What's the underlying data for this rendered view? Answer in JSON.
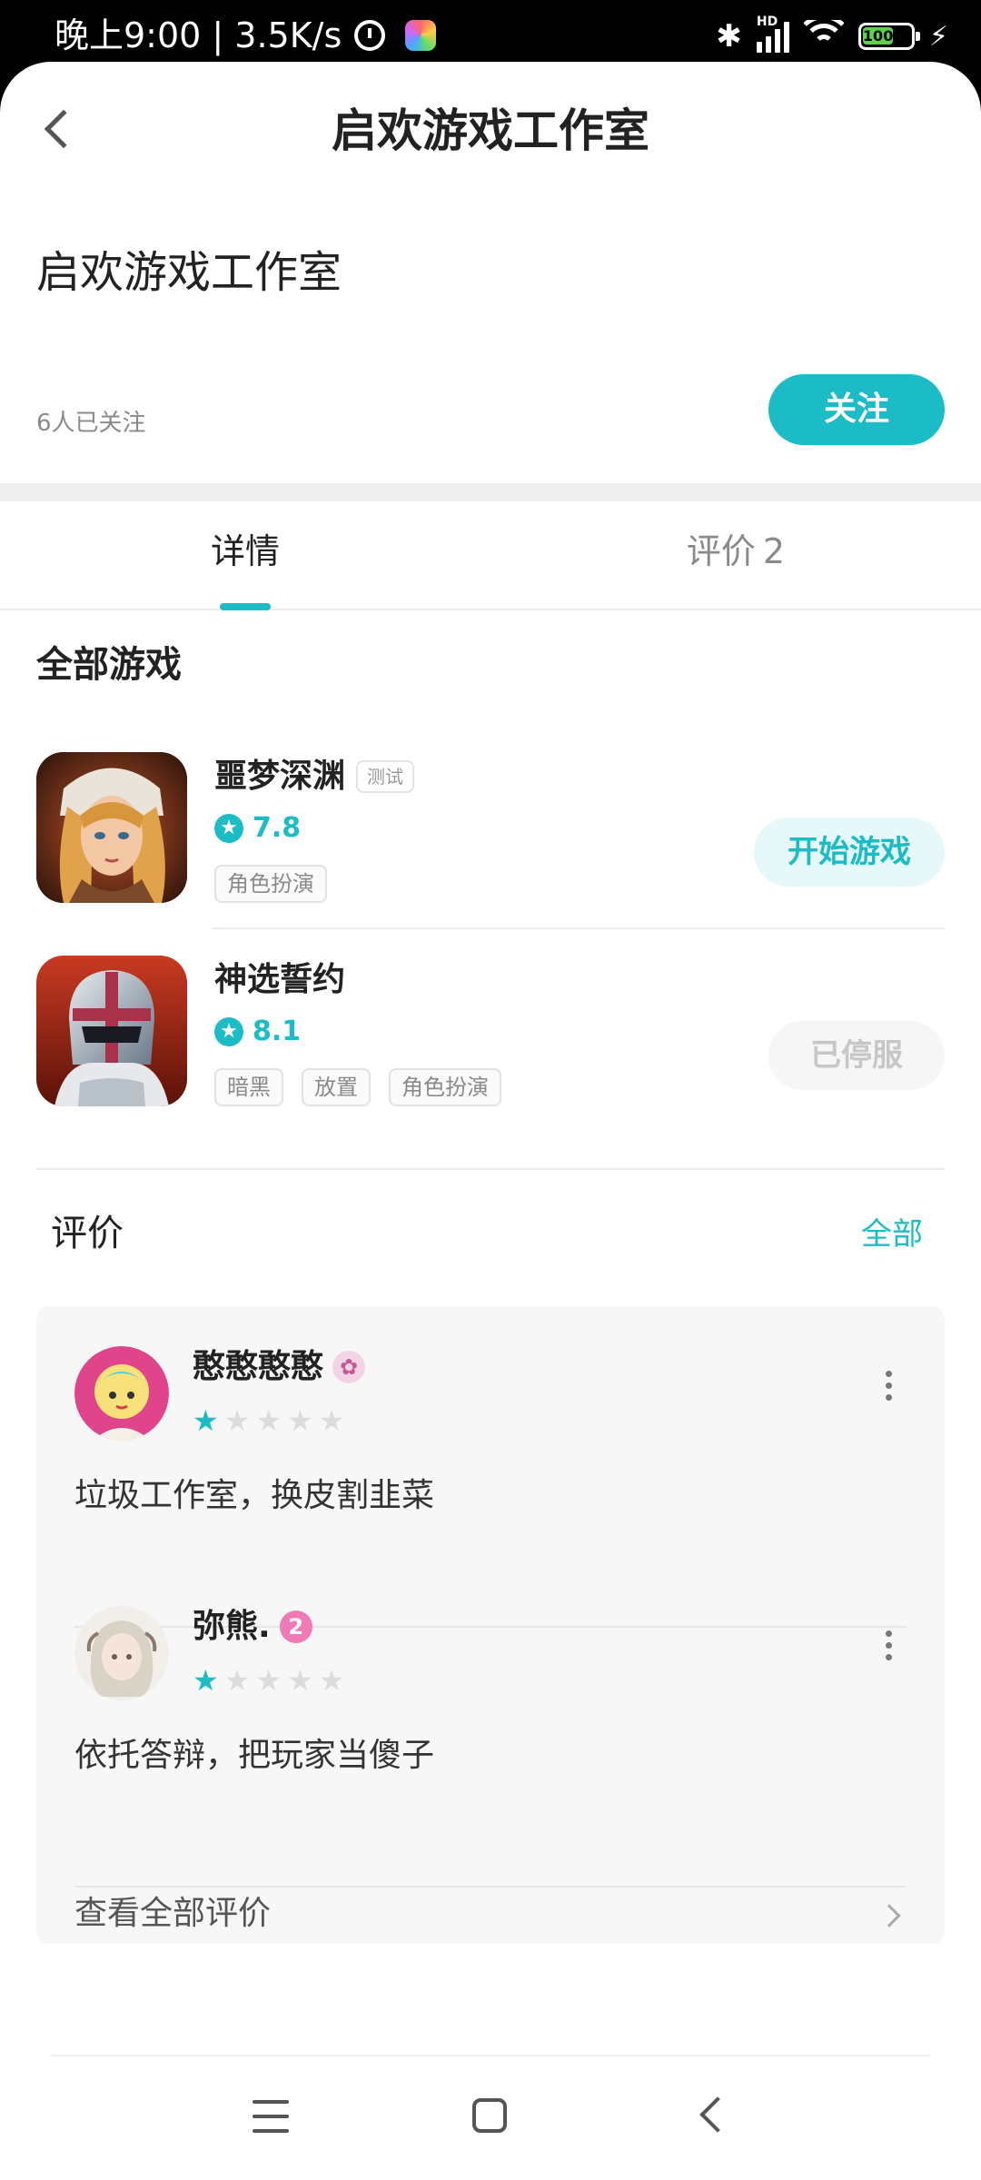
{
  "status_bar": {
    "left_text": "晚上9:00 | 3.5K/s",
    "bluetooth_glyph": "✱",
    "hd_label": "HD",
    "battery": "100",
    "bolt_glyph": "⚡"
  },
  "header": {
    "title": "启欢游戏工作室"
  },
  "profile": {
    "name": "启欢游戏工作室",
    "followers": "6人已关注",
    "follow_label": "关注"
  },
  "tabs": [
    {
      "label": "详情",
      "count": ""
    },
    {
      "label": "评价",
      "count": "2"
    }
  ],
  "games_section": {
    "title": "全部游戏",
    "games": [
      {
        "name": "噩梦深渊",
        "badge": "测试",
        "score": "7.8",
        "tags": [
          "角色扮演"
        ],
        "action": "开始游戏",
        "icon": "game-portrait-icon"
      },
      {
        "name": "神选誓约",
        "badge": "",
        "score": "8.1",
        "tags": [
          "暗黑",
          "放置",
          "角色扮演"
        ],
        "action": "已停服",
        "icon": "knight-helmet-icon"
      }
    ]
  },
  "reviews_section": {
    "title": "评价",
    "all_label": "全部",
    "reviews": [
      {
        "user": "憨憨憨憨",
        "badge": "✿",
        "rating": 1,
        "text": "垃圾工作室，换皮割韭菜"
      },
      {
        "user": "弥熊.",
        "badge": "2",
        "rating": 1,
        "text": "依托答辩，把玩家当傻子"
      }
    ],
    "see_all_label": "查看全部评价"
  },
  "glyphs": {
    "star": "★"
  },
  "colors": {
    "accent": "#1cbcc6",
    "accent_light": "#e6f8f9",
    "disabled_text": "#c7c7c7"
  }
}
